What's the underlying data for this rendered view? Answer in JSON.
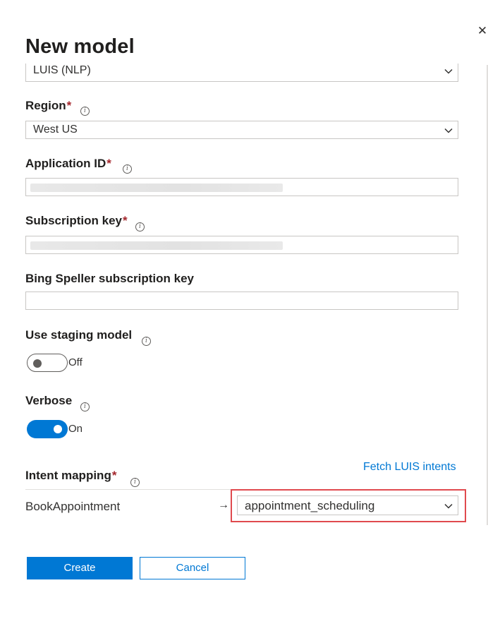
{
  "panel": {
    "title": "New model",
    "close_icon": "close-icon"
  },
  "fields": {
    "model_type": {
      "value": "LUIS (NLP)"
    },
    "region": {
      "label": "Region",
      "value": "West US"
    },
    "application_id": {
      "label": "Application ID"
    },
    "subscription_key": {
      "label": "Subscription key"
    },
    "bing_speller_key": {
      "label": "Bing Speller subscription key",
      "value": ""
    },
    "use_staging_model": {
      "label": "Use staging model",
      "state_text": "Off",
      "checked": false
    },
    "verbose": {
      "label": "Verbose",
      "state_text": "On",
      "checked": true
    },
    "required_marker": "*"
  },
  "intent_mapping": {
    "label": "Intent mapping",
    "fetch_link": "Fetch LUIS intents",
    "rows": [
      {
        "intent": "BookAppointment",
        "arrow": "→",
        "mapped_value": "appointment_scheduling"
      }
    ]
  },
  "footer": {
    "create_label": "Create",
    "cancel_label": "Cancel"
  },
  "colors": {
    "accent": "#0078d4",
    "required": "#a4262c",
    "highlight": "#e04a4e"
  }
}
